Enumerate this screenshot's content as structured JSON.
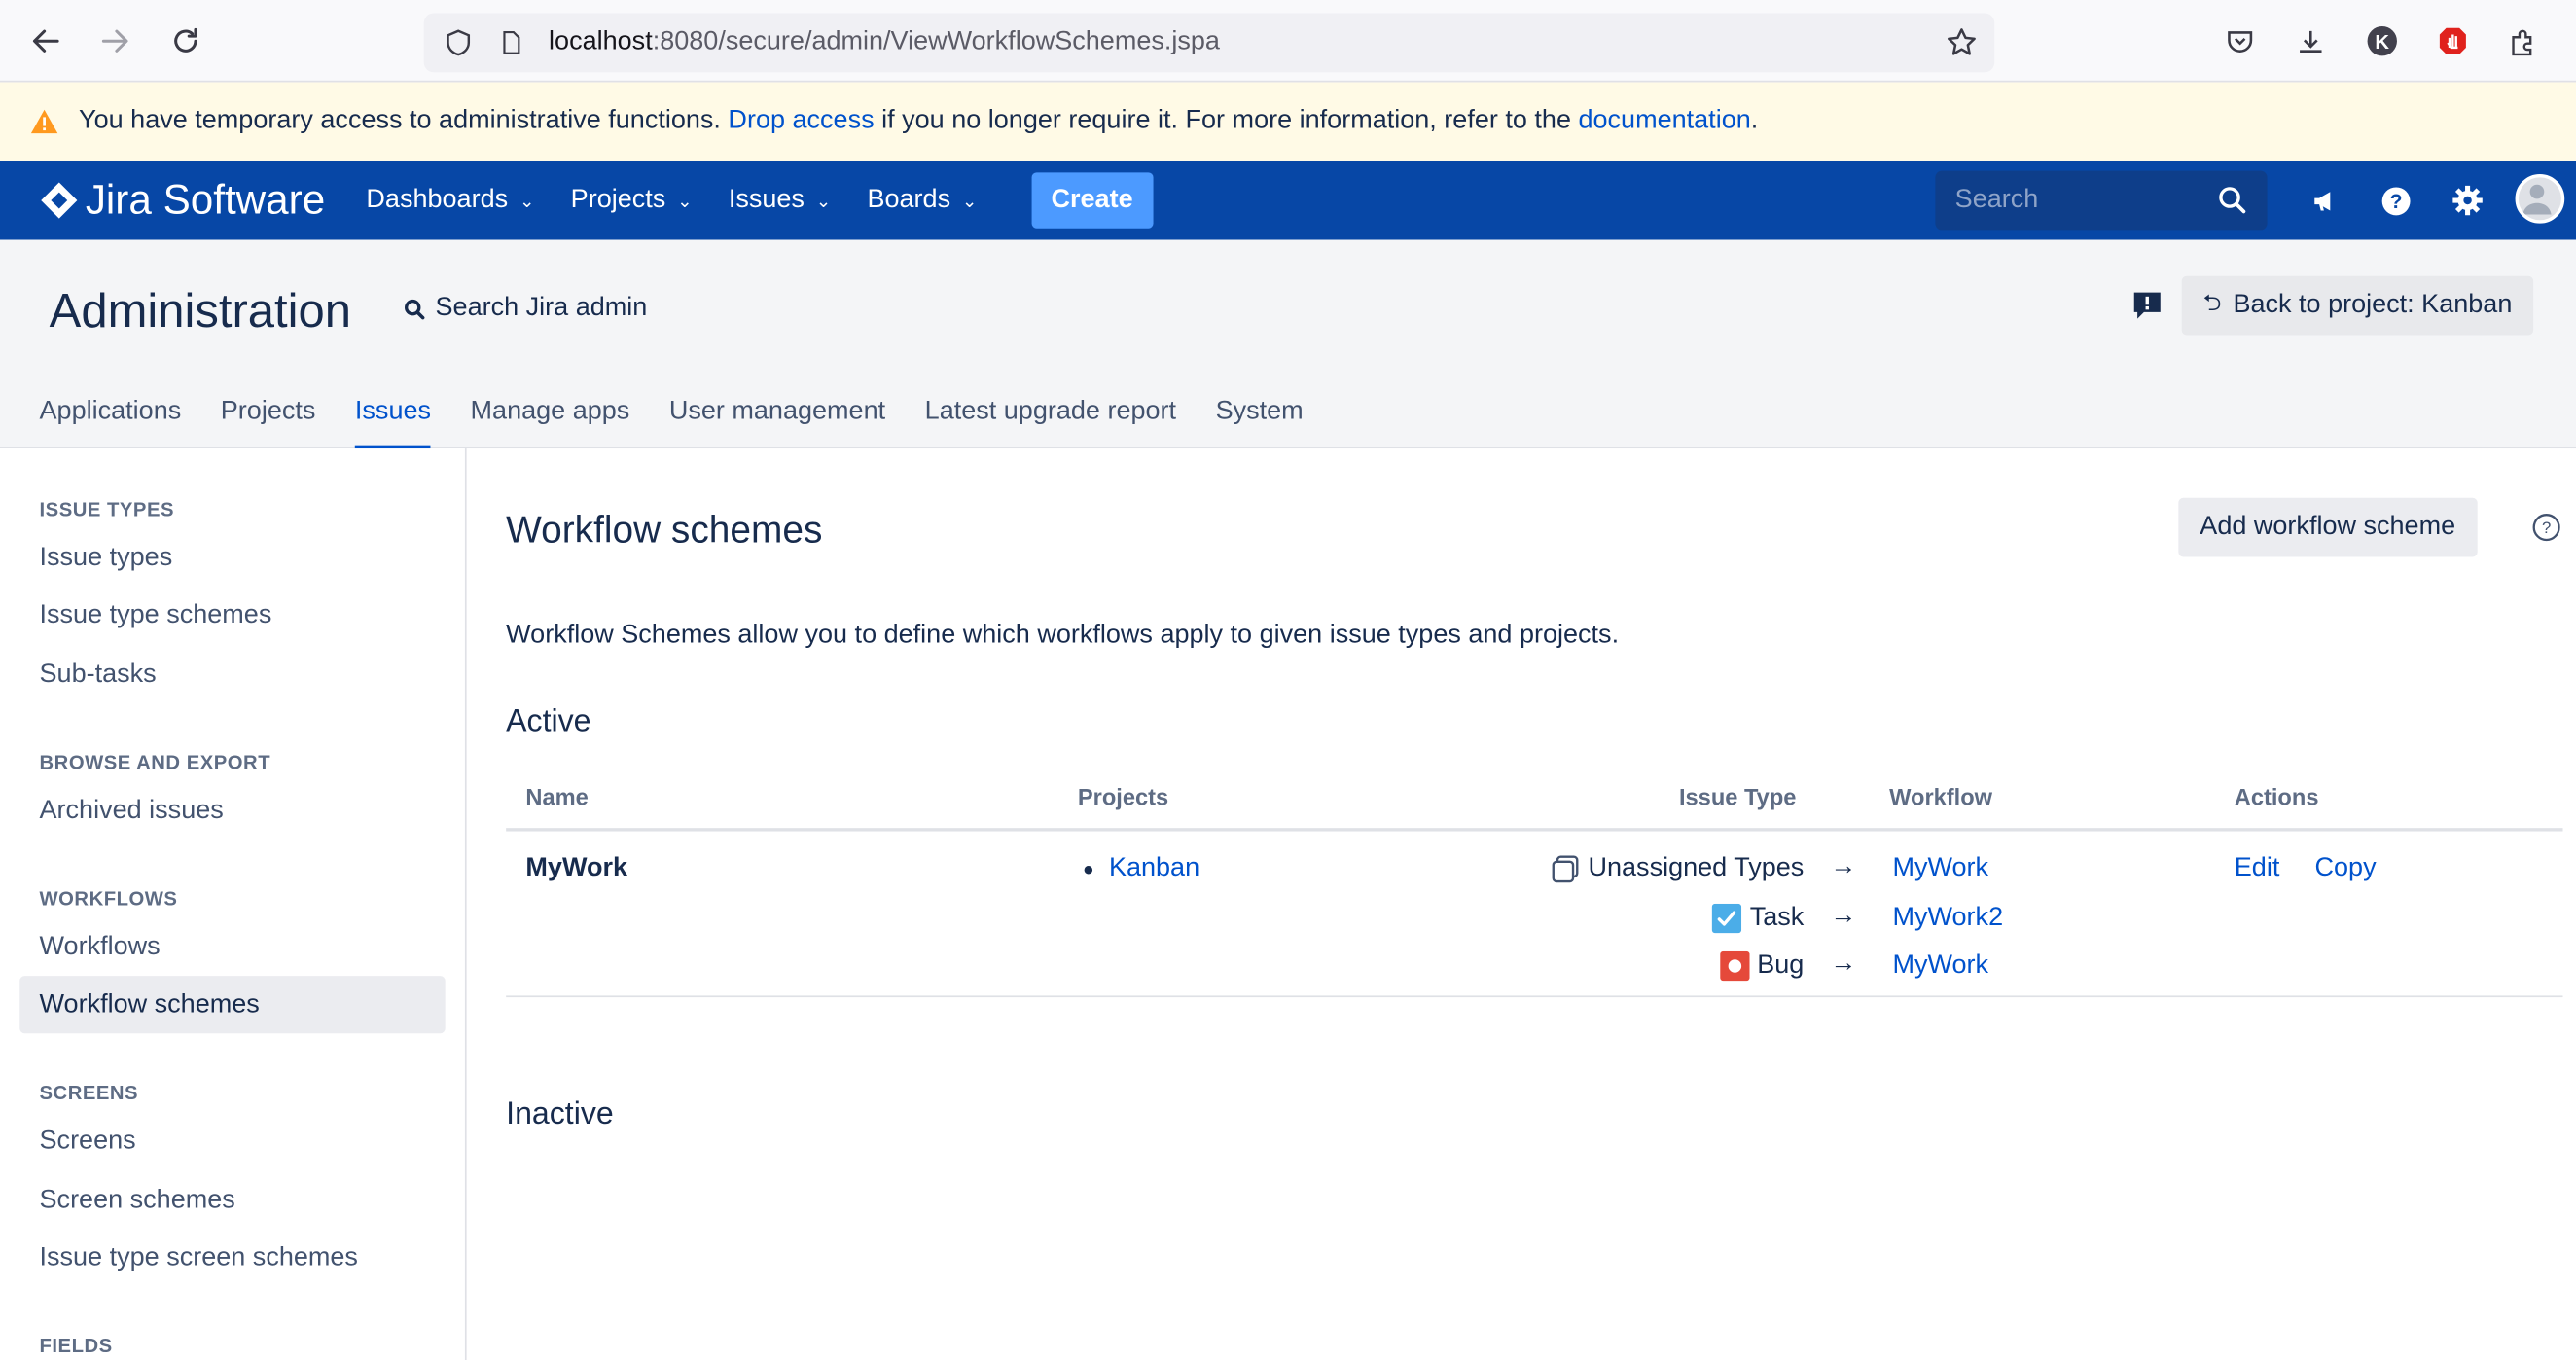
{
  "browser": {
    "url_host": "localhost",
    "url_rest": ":8080/secure/admin/ViewWorkflowSchemes.jspa"
  },
  "banner": {
    "text_before": "You have temporary access to administrative functions. ",
    "drop_link": "Drop access",
    "text_middle": " if you no longer require it. For more information, refer to the ",
    "doc_link": "documentation",
    "text_after": "."
  },
  "header": {
    "logo_text": "Jira Software",
    "nav": [
      {
        "label": "Dashboards"
      },
      {
        "label": "Projects"
      },
      {
        "label": "Issues"
      },
      {
        "label": "Boards"
      }
    ],
    "create_label": "Create",
    "search_placeholder": "Search",
    "colors": {
      "bar": "#0747a6",
      "create": "#4c9aff"
    }
  },
  "admin": {
    "title": "Administration",
    "search_label": "Search Jira admin",
    "back_button": "Back to project: Kanban",
    "tabs": [
      {
        "label": "Applications"
      },
      {
        "label": "Projects"
      },
      {
        "label": "Issues",
        "active": true
      },
      {
        "label": "Manage apps"
      },
      {
        "label": "User management"
      },
      {
        "label": "Latest upgrade report"
      },
      {
        "label": "System"
      }
    ]
  },
  "sidebar": {
    "sections": [
      {
        "title": "ISSUE TYPES",
        "items": [
          "Issue types",
          "Issue type schemes",
          "Sub-tasks"
        ]
      },
      {
        "title": "BROWSE AND EXPORT",
        "items": [
          "Archived issues"
        ]
      },
      {
        "title": "WORKFLOWS",
        "items": [
          "Workflows",
          "Workflow schemes"
        ]
      },
      {
        "title": "SCREENS",
        "items": [
          "Screens",
          "Screen schemes",
          "Issue type screen schemes"
        ]
      },
      {
        "title": "FIELDS",
        "items": []
      }
    ],
    "selected": "Workflow schemes"
  },
  "main": {
    "title": "Workflow schemes",
    "add_button": "Add workflow scheme",
    "description": "Workflow Schemes allow you to define which workflows apply to given issue types and projects.",
    "active_heading": "Active",
    "inactive_heading": "Inactive",
    "columns": {
      "name": "Name",
      "projects": "Projects",
      "issue_type": "Issue Type",
      "workflow": "Workflow",
      "actions": "Actions"
    },
    "rows": [
      {
        "name": "MyWork",
        "projects": [
          "Kanban"
        ],
        "mappings": [
          {
            "issue_type": "Unassigned Types",
            "icon": "unassigned-types-icon",
            "workflow": "MyWork"
          },
          {
            "issue_type": "Task",
            "icon": "task-icon",
            "workflow": "MyWork2"
          },
          {
            "issue_type": "Bug",
            "icon": "bug-icon",
            "workflow": "MyWork"
          }
        ],
        "actions": [
          "Edit",
          "Copy"
        ]
      }
    ]
  }
}
